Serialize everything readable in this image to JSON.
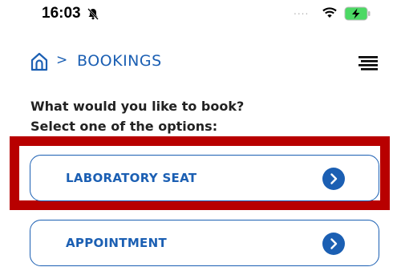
{
  "status_bar": {
    "time": "16:03",
    "signal_dots": "....",
    "icons": [
      "mute-icon",
      "wifi-icon",
      "battery-charging-icon"
    ]
  },
  "header": {
    "breadcrumb_separator": ">",
    "breadcrumb_label": "BOOKINGS",
    "icons": [
      "home-icon",
      "menu-icon"
    ]
  },
  "prompt": {
    "line1": "What would you like to book?",
    "line2": "Select one of the options:"
  },
  "options": [
    {
      "label": "LABORATORY SEAT",
      "icon": "chevron-right-circle-icon",
      "highlighted": true
    },
    {
      "label": "APPOINTMENT",
      "icon": "chevron-right-circle-icon",
      "highlighted": false
    }
  ],
  "colors": {
    "accent": "#1b5fb3",
    "highlight": "#b80000",
    "battery": "#4cd964"
  }
}
